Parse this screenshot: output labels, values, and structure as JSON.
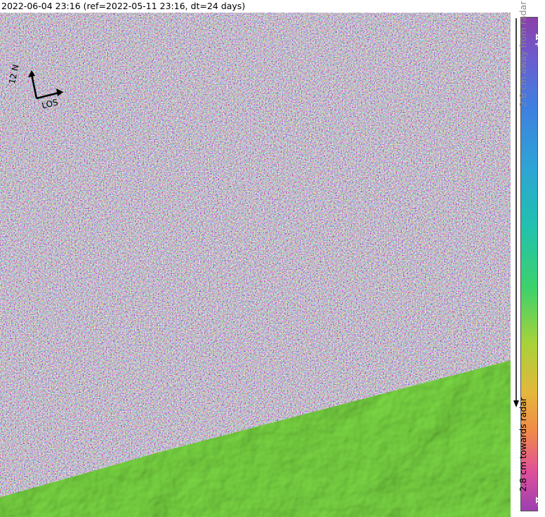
{
  "title": "2022-06-04 23:16 (ref=2022-05-11 23:16, dt=24 days)",
  "compass": {
    "north_label": "12 N",
    "los_label": "LOS"
  },
  "colorbar": {
    "top_label": "+π",
    "bottom_label": "-π",
    "away_label": "2.8 cm away from radar",
    "towards_label": "2.8 cm towards radar"
  },
  "colors": {
    "masked_land": "#6fcf3a",
    "phase_wrapped": "cyclic"
  }
}
